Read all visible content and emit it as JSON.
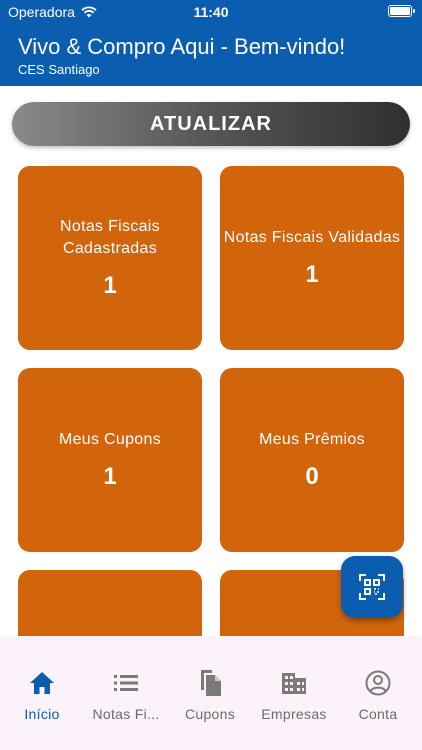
{
  "status_bar": {
    "carrier": "Operadora",
    "time": "11:40"
  },
  "header": {
    "title": "Vivo & Compro Aqui - Bem-vindo!",
    "subtitle": "CES Santiago"
  },
  "refresh_button": {
    "label": "ATUALIZAR"
  },
  "cards": [
    {
      "label": "Notas Fiscais Cadastradas",
      "value": "1"
    },
    {
      "label": "Notas Fiscais Validadas",
      "value": "1"
    },
    {
      "label": "Meus Cupons",
      "value": "1"
    },
    {
      "label": "Meus Prêmios",
      "value": "0"
    }
  ],
  "tabs": [
    {
      "label": "Início",
      "icon": "home-icon",
      "active": true
    },
    {
      "label": "Notas Fi...",
      "icon": "list-icon",
      "active": false
    },
    {
      "label": "Cupons",
      "icon": "copy-icon",
      "active": false
    },
    {
      "label": "Empresas",
      "icon": "building-icon",
      "active": false
    },
    {
      "label": "Conta",
      "icon": "account-icon",
      "active": false
    }
  ],
  "colors": {
    "primary": "#0b5db0",
    "card": "#d2640c",
    "tabbar": "#fbf2fa",
    "inactive": "#6b6b6b"
  }
}
